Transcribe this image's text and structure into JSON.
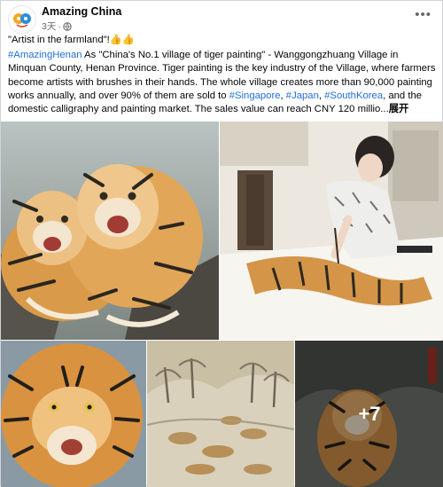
{
  "page": {
    "name": "Amazing China",
    "time": "3天"
  },
  "post": {
    "title_line": "\"Artist in the farmland\"!👍👍",
    "hashtag_main": "#AmazingHenan",
    "body_1": " As \"China's No.1 village of tiger painting\" - Wanggongzhuang Village in Minquan County, Henan Province. Tiger painting is the key industry of the Village, where farmers become artists with brushes in their hands. The whole village creates more than 90,000 painting works annually, and over 90% of them are sold to ",
    "tag_singapore": "#Singapore",
    "sep_1": ", ",
    "tag_japan": "#Japan",
    "sep_2": ", ",
    "tag_korea": "#SouthKorea",
    "body_2": ", and the domestic calligraphy and painting market. The sales value can reach CNY 120 millio...",
    "see_more": "展开"
  },
  "media": {
    "more_count": "+7"
  },
  "colors": {
    "link": "#216fdb",
    "secondary": "#65676b"
  }
}
